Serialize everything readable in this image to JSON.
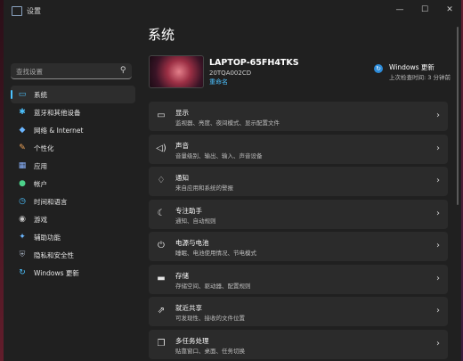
{
  "window": {
    "title": "设置"
  },
  "titlebar": {
    "minimize": "—",
    "maximize": "☐",
    "close": "✕"
  },
  "search": {
    "placeholder": "查找设置",
    "icon": "search-icon"
  },
  "nav": {
    "items": [
      {
        "label": "系统",
        "icon": "system-icon",
        "glyph": "▭",
        "color": "#4cc2ff",
        "selected": true
      },
      {
        "label": "蓝牙和其他设备",
        "icon": "bluetooth-icon",
        "glyph": "✱",
        "color": "#4cc2ff"
      },
      {
        "label": "网络 & Internet",
        "icon": "network-icon",
        "glyph": "◆",
        "color": "#6bb6ff"
      },
      {
        "label": "个性化",
        "icon": "personalize-icon",
        "glyph": "✎",
        "color": "#f0a55a"
      },
      {
        "label": "应用",
        "icon": "apps-icon",
        "glyph": "▦",
        "color": "#8ab4ff"
      },
      {
        "label": "帐户",
        "icon": "account-icon",
        "glyph": "●",
        "color": "#4cd18a"
      },
      {
        "label": "时间和语言",
        "icon": "time-language-icon",
        "glyph": "◷",
        "color": "#4cc2ff"
      },
      {
        "label": "游戏",
        "icon": "gaming-icon",
        "glyph": "◉",
        "color": "#c8c8c8"
      },
      {
        "label": "辅助功能",
        "icon": "accessibility-icon",
        "glyph": "✦",
        "color": "#6bb6ff"
      },
      {
        "label": "隐私和安全性",
        "icon": "privacy-icon",
        "glyph": "⛨",
        "color": "#9aa4b2"
      },
      {
        "label": "Windows 更新",
        "icon": "windows-update-icon",
        "glyph": "↻",
        "color": "#4cc2ff"
      }
    ]
  },
  "main": {
    "title": "系统",
    "device": {
      "name": "LAPTOP-65FH4TKS",
      "model": "20TQA002CD",
      "rename": "重命名"
    },
    "update": {
      "title": "Windows 更新",
      "subtitle": "上次检查时间: 3 分钟前"
    },
    "rows": [
      {
        "title": "显示",
        "subtitle": "监视器、亮度、夜间模式、显示配置文件",
        "icon": "display-icon",
        "glyph": "▭"
      },
      {
        "title": "声音",
        "subtitle": "音量级别、输出、输入、声音设备",
        "icon": "sound-icon",
        "glyph": "◁)"
      },
      {
        "title": "通知",
        "subtitle": "来自应用和系统的警报",
        "icon": "notification-icon",
        "glyph": "♢"
      },
      {
        "title": "专注助手",
        "subtitle": "通知、自动规则",
        "icon": "focus-assist-icon",
        "glyph": "☾"
      },
      {
        "title": "电源与电池",
        "subtitle": "睡眠、电池使用情况、节电模式",
        "icon": "power-icon",
        "glyph": "⏻"
      },
      {
        "title": "存储",
        "subtitle": "存储空间、驱动器、配置规则",
        "icon": "storage-icon",
        "glyph": "▬"
      },
      {
        "title": "就近共享",
        "subtitle": "可发现性、接收的文件位置",
        "icon": "nearby-share-icon",
        "glyph": "⇗"
      },
      {
        "title": "多任务处理",
        "subtitle": "贴靠窗口、桌面、任务切换",
        "icon": "multitasking-icon",
        "glyph": "❐"
      }
    ],
    "chevron": "›"
  }
}
